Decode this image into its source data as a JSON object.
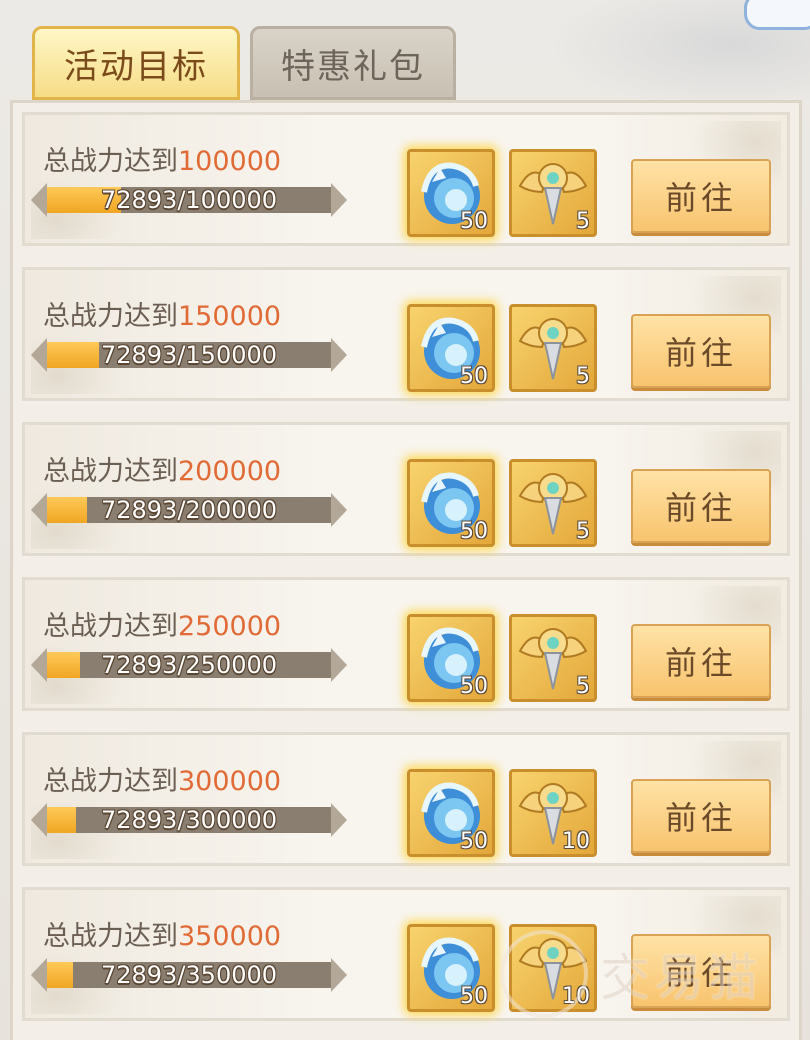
{
  "tabs": [
    {
      "label": "活动目标",
      "active": true
    },
    {
      "label": "特惠礼包",
      "active": false
    }
  ],
  "rows": [
    {
      "label_prefix": "总战力达到",
      "target": "100000",
      "progress_text": "72893/100000",
      "progress": 0.72893,
      "reward1_qty": "50",
      "reward2_qty": "5",
      "button": "前往"
    },
    {
      "label_prefix": "总战力达到",
      "target": "150000",
      "progress_text": "72893/150000",
      "progress": 0.48595,
      "reward1_qty": "50",
      "reward2_qty": "5",
      "button": "前往"
    },
    {
      "label_prefix": "总战力达到",
      "target": "200000",
      "progress_text": "72893/200000",
      "progress": 0.36447,
      "reward1_qty": "50",
      "reward2_qty": "5",
      "button": "前往"
    },
    {
      "label_prefix": "总战力达到",
      "target": "250000",
      "progress_text": "72893/250000",
      "progress": 0.29157,
      "reward1_qty": "50",
      "reward2_qty": "5",
      "button": "前往"
    },
    {
      "label_prefix": "总战力达到",
      "target": "300000",
      "progress_text": "72893/300000",
      "progress": 0.24298,
      "reward1_qty": "50",
      "reward2_qty": "10",
      "button": "前往"
    },
    {
      "label_prefix": "总战力达到",
      "target": "350000",
      "progress_text": "72893/350000",
      "progress": 0.20827,
      "reward1_qty": "50",
      "reward2_qty": "10",
      "button": "前往"
    }
  ],
  "reward_icons": [
    "blue-swirl-orb-icon",
    "golden-winged-crest-icon"
  ],
  "watermark": "交易猫",
  "colors": {
    "accent_number": "#e06b36",
    "progress_fill": "#f0a623",
    "button": "#f8c46e"
  }
}
